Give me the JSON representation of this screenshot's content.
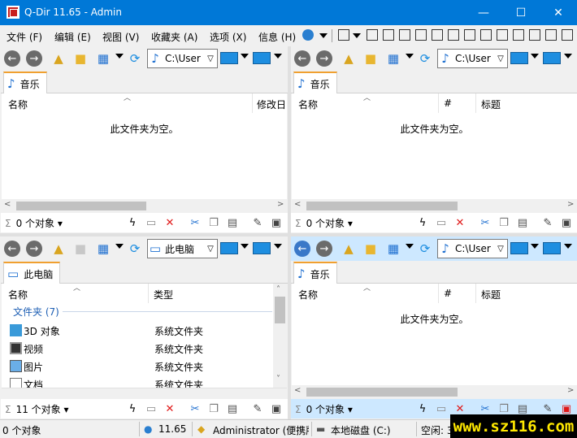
{
  "window": {
    "title": "Q-Dir 11.65 - Admin",
    "controls": {
      "minimize": "—",
      "maximize": "☐",
      "close": "✕"
    }
  },
  "menubar": {
    "items": [
      "文件 (F)",
      "编辑 (E)",
      "视图 (V)",
      "收藏夹 (A)",
      "选项 (X)",
      "信息 (H)"
    ]
  },
  "panes": [
    {
      "id": "top-left",
      "address": "C:\\User",
      "tab": "音乐",
      "tab_icon": "music-note-icon",
      "columns": [
        "名称",
        "修改日"
      ],
      "empty_text": "此文件夹为空。",
      "count": "0 个对象",
      "active": false
    },
    {
      "id": "top-right",
      "address": "C:\\User",
      "tab": "音乐",
      "tab_icon": "music-note-icon",
      "columns": [
        "名称",
        "#",
        "标题"
      ],
      "empty_text": "此文件夹为空。",
      "count": "0 个对象",
      "active": false
    },
    {
      "id": "bottom-left",
      "address": "此电脑",
      "tab": "此电脑",
      "tab_icon": "computer-icon",
      "columns": [
        "名称",
        "类型"
      ],
      "group": "文件夹 (7)",
      "rows": [
        {
          "name": "3D 对象",
          "type": "系统文件夹",
          "icon": "3d-objects-icon"
        },
        {
          "name": "视频",
          "type": "系统文件夹",
          "icon": "video-icon"
        },
        {
          "name": "图片",
          "type": "系统文件夹",
          "icon": "pictures-icon"
        },
        {
          "name": "文档",
          "type": "系统文件夹",
          "icon": "documents-icon"
        }
      ],
      "count": "11 个对象",
      "active": false
    },
    {
      "id": "bottom-right",
      "address": "C:\\User",
      "tab": "音乐",
      "tab_icon": "music-note-icon",
      "columns": [
        "名称",
        "#",
        "标题"
      ],
      "empty_text": "此文件夹为空。",
      "count": "0 个对象",
      "active": true
    }
  ],
  "statusbar": {
    "selection": "0 个对象",
    "version": "11.65",
    "user": "Administrator (便携版",
    "drive": "本地磁盘 (C:)",
    "free": "空闲: 3"
  },
  "watermark": "www.sz116.com",
  "colors": {
    "titlebar": "#0078d7",
    "active_status": "#cde8ff",
    "tab_accent": "#f0a030",
    "group_text": "#1e5fb4"
  }
}
